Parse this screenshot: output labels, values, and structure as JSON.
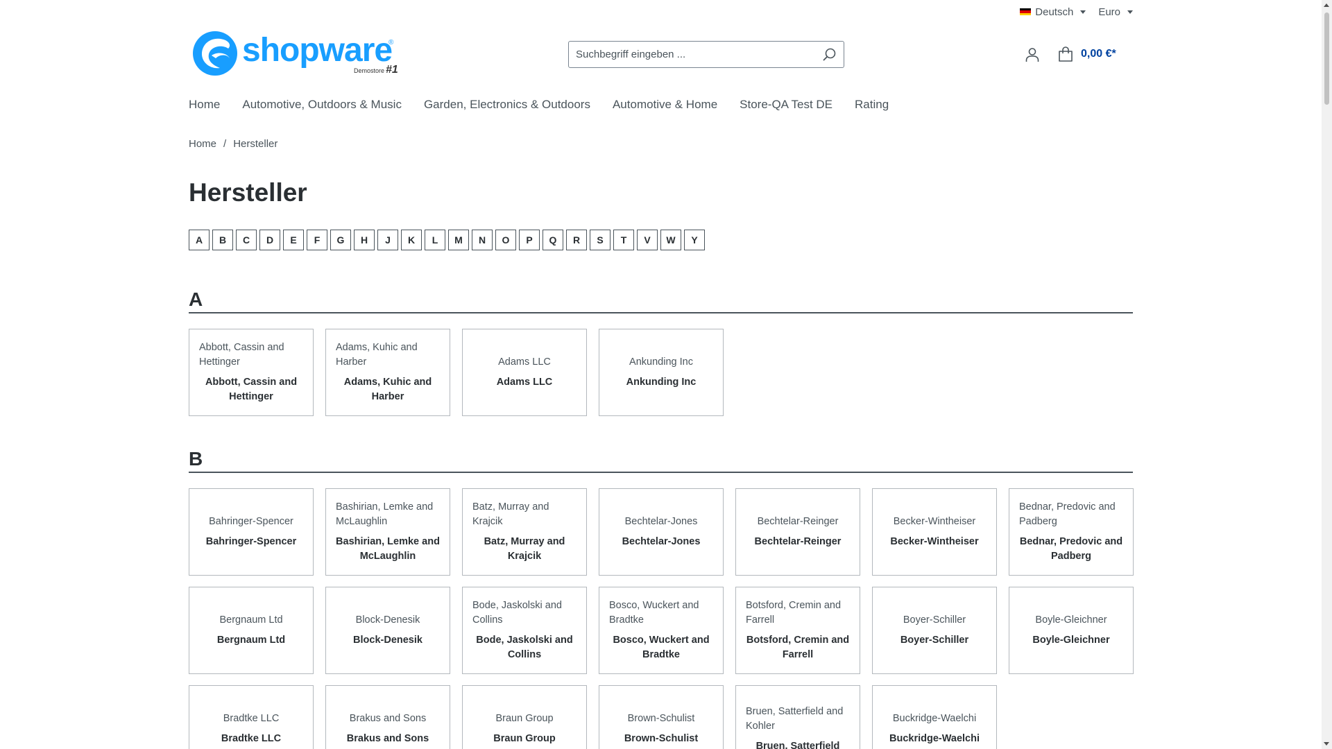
{
  "topbar": {
    "language": "Deutsch",
    "currency": "Euro",
    "flag_colors": [
      "#000000",
      "#dd0000",
      "#ffce00"
    ]
  },
  "logo": {
    "text": "shopware",
    "sub": "Demostore",
    "num": "#1",
    "color": "#189eff"
  },
  "search": {
    "placeholder": "Suchbegriff eingeben ..."
  },
  "cart": {
    "total": "0,00 €*",
    "accent": "#0042a0"
  },
  "nav": [
    "Home",
    "Automotive, Outdoors & Music",
    "Garden, Electronics & Outdoors",
    "Automotive & Home",
    "Store-QA Test DE",
    "Rating"
  ],
  "breadcrumb": {
    "home": "Home",
    "separator": "/",
    "current": "Hersteller"
  },
  "page_title": "Hersteller",
  "letters": [
    "A",
    "B",
    "C",
    "D",
    "E",
    "F",
    "G",
    "H",
    "J",
    "K",
    "L",
    "M",
    "N",
    "O",
    "P",
    "Q",
    "R",
    "S",
    "T",
    "V",
    "W",
    "Y"
  ],
  "sections": [
    {
      "letter": "A",
      "manufacturers": [
        {
          "img": "Abbott, Cassin and Hettinger",
          "name": "Abbott, Cassin and Hettinger"
        },
        {
          "img": "Adams, Kuhic and Harber",
          "name": "Adams, Kuhic and Harber"
        },
        {
          "img": "Adams LLC",
          "name": "Adams LLC"
        },
        {
          "img": "Ankunding Inc",
          "name": "Ankunding Inc"
        }
      ]
    },
    {
      "letter": "B",
      "manufacturers": [
        {
          "img": "Bahringer-Spencer",
          "name": "Bahringer-Spencer"
        },
        {
          "img": "Bashirian, Lemke and McLaughlin",
          "name": "Bashirian, Lemke and McLaughlin"
        },
        {
          "img": "Batz, Murray and Krajcik",
          "name": "Batz, Murray and Krajcik"
        },
        {
          "img": "Bechtelar-Jones",
          "name": "Bechtelar-Jones"
        },
        {
          "img": "Bechtelar-Reinger",
          "name": "Bechtelar-Reinger"
        },
        {
          "img": "Becker-Wintheiser",
          "name": "Becker-Wintheiser"
        },
        {
          "img": "Bednar, Predovic and Padberg",
          "name": "Bednar, Predovic and Padberg"
        },
        {
          "img": "Bergnaum Ltd",
          "name": "Bergnaum Ltd"
        },
        {
          "img": "Block-Denesik",
          "name": "Block-Denesik"
        },
        {
          "img": "Bode, Jaskolski and Collins",
          "name": "Bode, Jaskolski and Collins"
        },
        {
          "img": "Bosco, Wuckert and Bradtke",
          "name": "Bosco, Wuckert and Bradtke"
        },
        {
          "img": "Botsford, Cremin and Farrell",
          "name": "Botsford, Cremin and Farrell"
        },
        {
          "img": "Boyer-Schiller",
          "name": "Boyer-Schiller"
        },
        {
          "img": "Boyle-Gleichner",
          "name": "Boyle-Gleichner"
        },
        {
          "img": "Bradtke LLC",
          "name": "Bradtke LLC"
        },
        {
          "img": "Brakus and Sons",
          "name": "Brakus and Sons"
        },
        {
          "img": "Braun Group",
          "name": "Braun Group"
        },
        {
          "img": "Brown-Schulist",
          "name": "Brown-Schulist"
        },
        {
          "img": "Bruen, Satterfield and Kohler",
          "name": "Bruen, Satterfield"
        },
        {
          "img": "Buckridge-Waelchi",
          "name": "Buckridge-Waelchi"
        }
      ]
    }
  ]
}
